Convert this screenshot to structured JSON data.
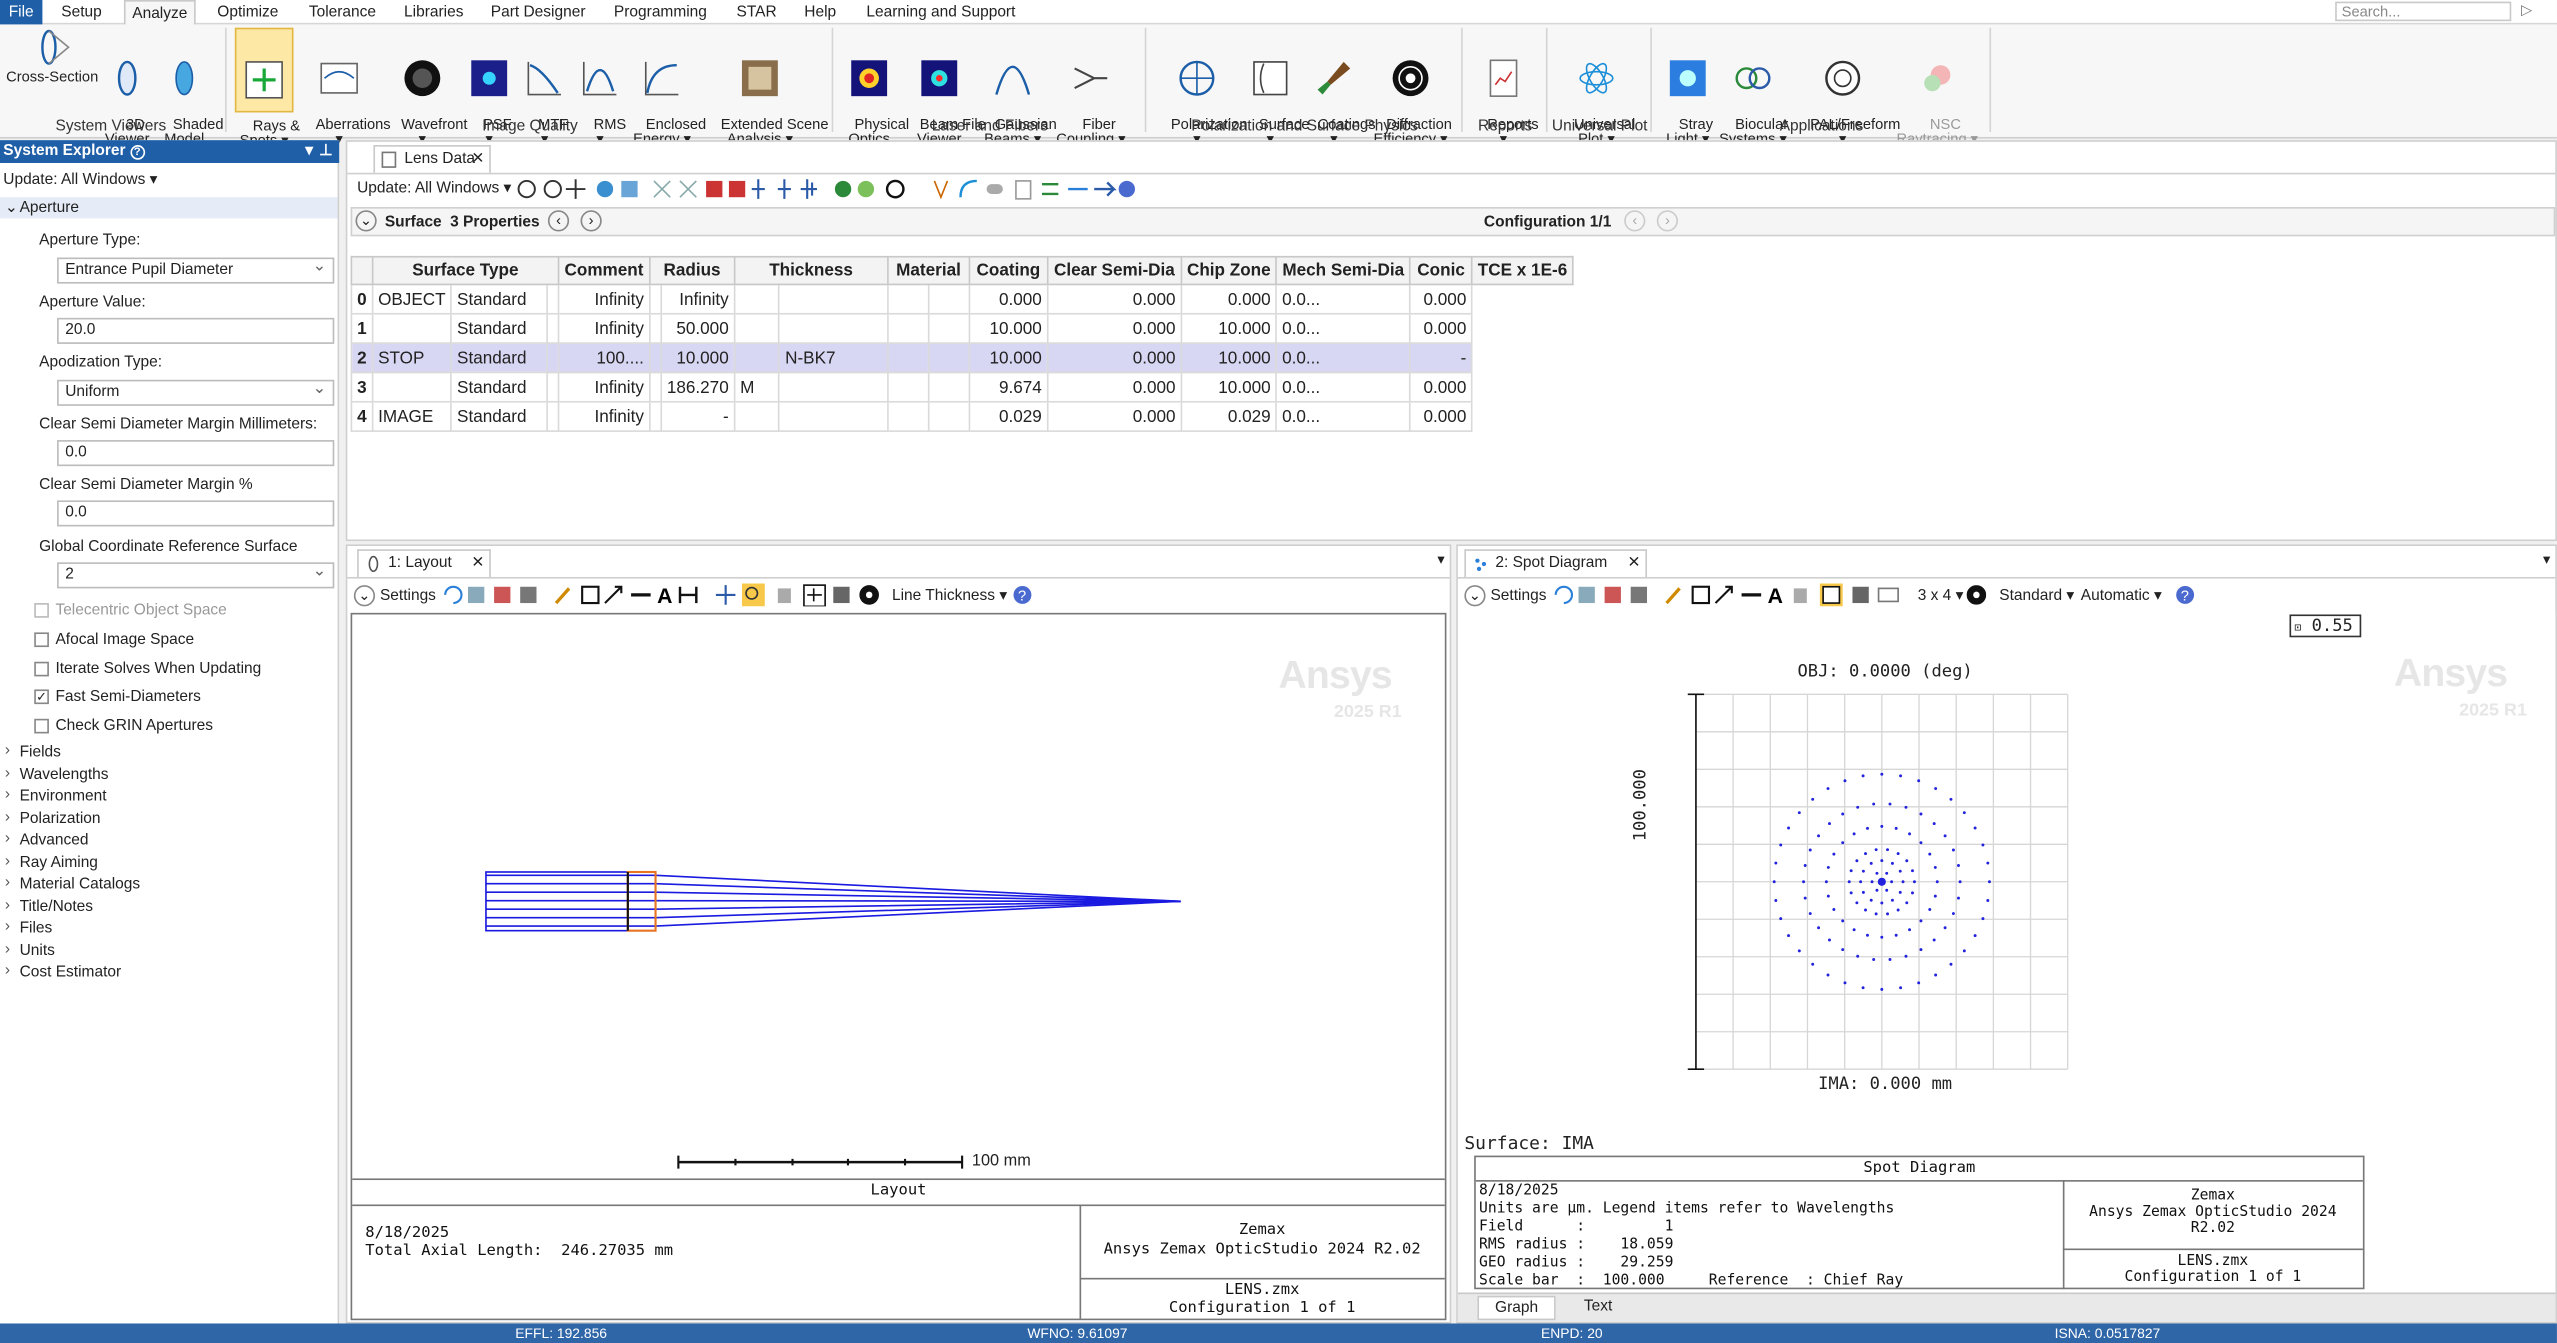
{
  "menu": {
    "items": [
      "File",
      "Setup",
      "Analyze",
      "Optimize",
      "Tolerance",
      "Libraries",
      "Part Designer",
      "Programming",
      "STAR",
      "Help",
      "Learning and Support"
    ],
    "search_placeholder": "Search..."
  },
  "ribbon": {
    "buttons": [
      "Cross-Section",
      "3D\nViewer",
      "Shaded\nModel",
      "Rays &\nSpots ▾",
      "Aberrations\n▾",
      "Wavefront\n▾",
      "PSF\n▾",
      "MTF\n▾",
      "RMS\n▾",
      "Enclosed\nEnergy ▾",
      "Extended Scene\nAnalysis ▾",
      "Physical\nOptics",
      "Beam File\nViewer",
      "Gaussian\nBeams ▾",
      "Fiber\nCoupling ▾",
      "Polarization\n▾",
      "Surface\n▾",
      "Coatings\n▾",
      "Diffraction\nEfficiency ▾",
      "Reports\n▾",
      "Universal\nPlot ▾",
      "Stray\nLight ▾",
      "Biocular\nSystems ▾",
      "PAL/Freeform\n▾",
      "NSC\nRaytracing ▾"
    ],
    "groups": [
      "System Viewers",
      "Image Quality",
      "Laser and Fibers",
      "Polarization and Surface Physics",
      "Reports",
      "Universal Plot",
      "Applications"
    ]
  },
  "explorer": {
    "title": "System Explorer",
    "update": "Update: All Windows ▾",
    "section": "Aperture",
    "aperture_type_label": "Aperture Type:",
    "aperture_type": "Entrance Pupil Diameter",
    "aperture_value_label": "Aperture Value:",
    "aperture_value": "20.0",
    "apodization_label": "Apodization Type:",
    "apodization": "Uniform",
    "margin_mm_label": "Clear Semi Diameter Margin Millimeters:",
    "margin_mm": "0.0",
    "margin_pct_label": "Clear Semi Diameter Margin %",
    "margin_pct": "0.0",
    "gcrs_label": "Global Coordinate Reference Surface",
    "gcrs": "2",
    "checks": [
      {
        "label": "Telecentric Object Space",
        "checked": false,
        "disabled": true
      },
      {
        "label": "Afocal Image Space",
        "checked": false
      },
      {
        "label": "Iterate Solves When Updating",
        "checked": false
      },
      {
        "label": "Fast Semi-Diameters",
        "checked": true
      },
      {
        "label": "Check GRIN Apertures",
        "checked": false
      }
    ],
    "tree": [
      "Fields",
      "Wavelengths",
      "Environment",
      "Polarization",
      "Advanced",
      "Ray Aiming",
      "Material Catalogs",
      "Title/Notes",
      "Files",
      "Units",
      "Cost Estimator"
    ]
  },
  "lens": {
    "tab": "Lens Data",
    "update": "Update: All Windows ▾",
    "surface": "Surface",
    "props": "3 Properties",
    "config": "Configuration 1/1",
    "headers": [
      "",
      "Surface Type",
      "",
      "Comment",
      "Radius",
      "",
      "Thickness",
      "",
      "Material",
      "",
      "Coating",
      "Clear Semi-Dia",
      "Chip Zone",
      "Mech Semi-Dia",
      "Conic",
      "TCE x 1E-6"
    ],
    "rows": [
      [
        "0",
        "OBJECT",
        "Standard",
        "",
        "Infinity",
        "",
        "Infinity",
        "",
        "",
        "",
        "",
        "0.000",
        "0.000",
        "0.000",
        "0.0...",
        "0.000"
      ],
      [
        "1",
        "",
        "Standard",
        "",
        "Infinity",
        "",
        "50.000",
        "",
        "",
        "",
        "",
        "10.000",
        "0.000",
        "10.000",
        "0.0...",
        "0.000"
      ],
      [
        "2",
        "STOP",
        "Standard",
        "",
        "100....",
        "",
        "10.000",
        "",
        "N-BK7",
        "",
        "",
        "10.000",
        "0.000",
        "10.000",
        "0.0...",
        "-"
      ],
      [
        "3",
        "",
        "Standard",
        "",
        "Infinity",
        "",
        "186.270",
        "M",
        "",
        "",
        "",
        "9.674",
        "0.000",
        "10.000",
        "0.0...",
        "0.000"
      ],
      [
        "4",
        "IMAGE",
        "Standard",
        "",
        "Infinity",
        "",
        "-",
        "",
        "",
        "",
        "",
        "0.029",
        "0.000",
        "0.029",
        "0.0...",
        "0.000"
      ]
    ]
  },
  "layout": {
    "tab": "1: Layout",
    "settings": "Settings",
    "line_thickness": "Line Thickness ▾",
    "scale": "100 mm",
    "footer_title": "Layout",
    "date": "8/18/2025",
    "total_axial": "Total Axial Length:  246.27035 mm",
    "company": "Zemax",
    "product": "Ansys Zemax OpticStudio 2024 R2.02",
    "file": "LENS.zmx",
    "config": "Configuration 1 of 1"
  },
  "spot": {
    "tab": "2: Spot Diagram",
    "settings": "Settings",
    "grid": "3 x 4 ▾",
    "standard": "Standard ▾",
    "automatic": "Automatic ▾",
    "field_value": "0.55",
    "obj": "OBJ: 0.0000 (deg)",
    "ima": "IMA: 0.000 mm",
    "yscale": "100.000",
    "surface": "Surface: IMA",
    "footer_title": "Spot Diagram",
    "date": "8/18/2025",
    "units": "Units are µm. Legend items refer to Wavelengths",
    "field": "Field      :         1",
    "rms": "RMS radius :    18.059",
    "geo": "GEO radius :    29.259",
    "scalebar": "Scale bar  :  100.000     Reference  : Chief Ray",
    "company": "Zemax",
    "product": "Ansys Zemax OpticStudio 2024 R2.02",
    "file": "LENS.zmx",
    "config": "Configuration 1 of 1",
    "tabs": [
      "Graph",
      "Text"
    ]
  },
  "watermark": {
    "brand": "Ansys",
    "version": "2025 R1"
  },
  "status": {
    "effl": "EFFL: 192.856",
    "wfno": "WFNO: 9.61097",
    "enpd": "ENPD: 20",
    "isna": "ISNA: 0.0517827"
  }
}
